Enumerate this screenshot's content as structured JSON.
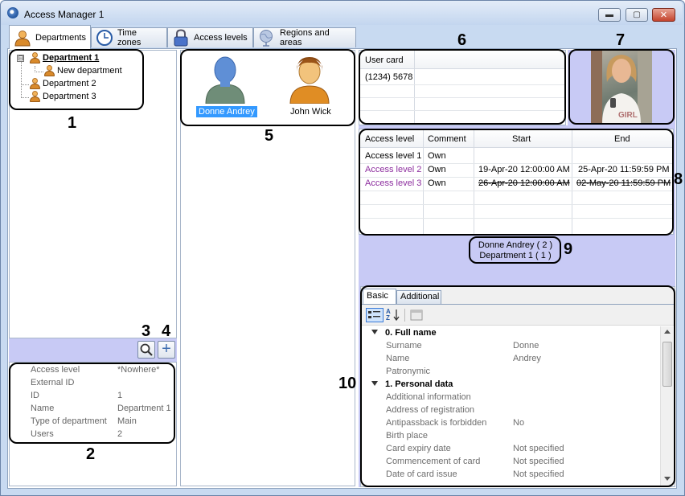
{
  "window": {
    "title": "Access Manager 1",
    "accent": "#c8caf5",
    "buttons": {
      "minimize": "▬",
      "maximize": "▢",
      "close": "✕"
    }
  },
  "tabs": [
    {
      "label": "Departments",
      "icon": "person-icon",
      "active": true
    },
    {
      "label": "Time zones",
      "icon": "clock-icon"
    },
    {
      "label": "Access levels",
      "icon": "lock-icon"
    },
    {
      "label": "Regions and areas",
      "icon": "globe-icon"
    }
  ],
  "tree": {
    "root": "Department 1",
    "root_toggle": "⊟",
    "child": "New department",
    "siblings": [
      "Department 2",
      "Department 3"
    ]
  },
  "toolbar": {
    "search_icon": "magnifier-icon",
    "add_icon": "plus-icon",
    "add_symbol": "+"
  },
  "department_props": [
    {
      "key": "Access level",
      "value": "*Nowhere*"
    },
    {
      "key": "External ID",
      "value": ""
    },
    {
      "key": "ID",
      "value": "1"
    },
    {
      "key": "Name",
      "value": "Department 1"
    },
    {
      "key": "Type of department",
      "value": "Main"
    },
    {
      "key": "Users",
      "value": "2"
    }
  ],
  "users": [
    {
      "name": "Donne Andrey",
      "selected": true,
      "color": "#4f86d8"
    },
    {
      "name": "John Wick",
      "selected": false,
      "color": "#d98a2b"
    }
  ],
  "cards": {
    "header": "User card",
    "rows": [
      "(1234) 5678"
    ]
  },
  "photo": {
    "caption": "GIRL"
  },
  "access_table": {
    "headers": [
      "Access level",
      "Comment",
      "Start",
      "End"
    ],
    "rows": [
      {
        "level": "Access level 1",
        "comment": "Own",
        "start": "",
        "end": "",
        "style": "normal"
      },
      {
        "level": "Access level 2",
        "comment": "Own",
        "start": "19-Apr-20 12:00:00 AM",
        "end": "25-Apr-20 11:59:59 PM",
        "style": "purple"
      },
      {
        "level": "Access level 3",
        "comment": "Own",
        "start": "26-Apr-20 12:00:00 AM",
        "end": "02-May-20 11:59:59 PM",
        "style": "strike"
      }
    ]
  },
  "summary": {
    "line1": "Donne Andrey ( 2 )",
    "line2": "Department 1 ( 1 )"
  },
  "details": {
    "tabs": [
      "Basic",
      "Additional"
    ],
    "tool_icons": [
      "categorized-icon",
      "sort-az-icon",
      "property-pages-icon"
    ],
    "sort_label": "A Z",
    "groups": [
      {
        "title": "0. Full name",
        "rows": [
          {
            "key": "Surname",
            "value": "Donne"
          },
          {
            "key": "Name",
            "value": "Andrey"
          },
          {
            "key": "Patronymic",
            "value": ""
          }
        ]
      },
      {
        "title": "1. Personal data",
        "rows": [
          {
            "key": "Additional information",
            "value": ""
          },
          {
            "key": "Address of registration",
            "value": ""
          },
          {
            "key": "Antipassback is forbidden",
            "value": "No"
          },
          {
            "key": "Birth place",
            "value": ""
          },
          {
            "key": "Card expiry date",
            "value": "Not specified"
          },
          {
            "key": "Commencement of card",
            "value": "Not specified"
          },
          {
            "key": "Date of card issue",
            "value": "Not specified"
          }
        ]
      }
    ]
  },
  "callouts": [
    "1",
    "2",
    "3",
    "4",
    "5",
    "6",
    "7",
    "8",
    "9",
    "10"
  ]
}
